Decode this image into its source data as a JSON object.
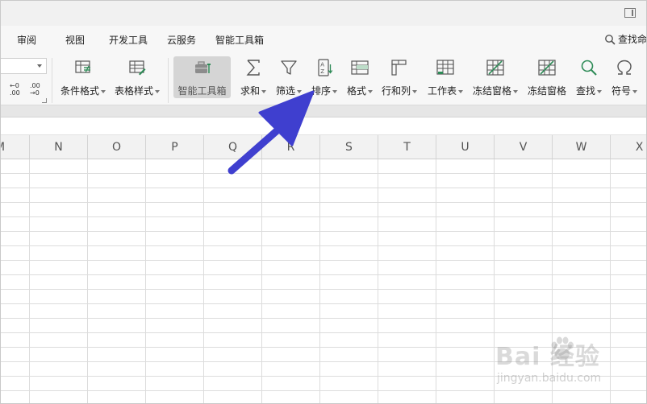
{
  "menu": {
    "items": [
      "审阅",
      "视图",
      "开发工具",
      "云服务",
      "智能工具箱"
    ],
    "search_label": "查找命"
  },
  "ribbon": {
    "decimal_increase": [
      "←0",
      ".00"
    ],
    "decimal_decrease": [
      ".00",
      "→0"
    ],
    "tools": [
      {
        "label": "条件格式",
        "icon": "conditional-format-icon",
        "dropdown": true
      },
      {
        "label": "表格样式",
        "icon": "table-style-icon",
        "dropdown": true
      },
      {
        "label": "智能工具箱",
        "icon": "toolbox-icon",
        "dropdown": false,
        "active": true
      },
      {
        "label": "求和",
        "icon": "sum-icon",
        "dropdown": true
      },
      {
        "label": "筛选",
        "icon": "filter-icon",
        "dropdown": true
      },
      {
        "label": "排序",
        "icon": "sort-icon",
        "dropdown": true
      },
      {
        "label": "格式",
        "icon": "format-icon",
        "dropdown": true
      },
      {
        "label": "行和列",
        "icon": "row-col-icon",
        "dropdown": true
      },
      {
        "label": "工作表",
        "icon": "worksheet-icon",
        "dropdown": true
      },
      {
        "label": "冻结窗格",
        "icon": "freeze-pane-icon",
        "dropdown": true
      },
      {
        "label": "冻结窗格",
        "icon": "freeze-pane-icon",
        "dropdown": false
      },
      {
        "label": "查找",
        "icon": "search-icon",
        "dropdown": true
      },
      {
        "label": "符号",
        "icon": "omega-symbol-icon",
        "dropdown": true
      }
    ]
  },
  "sheet": {
    "columns": [
      "M",
      "N",
      "O",
      "P",
      "Q",
      "R",
      "S",
      "T",
      "U",
      "V",
      "W",
      "X"
    ]
  },
  "watermark": {
    "main": "Bai 经验",
    "sub": "jingyan.baidu.com"
  },
  "colors": {
    "arrow": "#3f3fcf",
    "active_tool_bg": "#d5d5d5",
    "ribbon_bg": "#f7f7f7"
  }
}
